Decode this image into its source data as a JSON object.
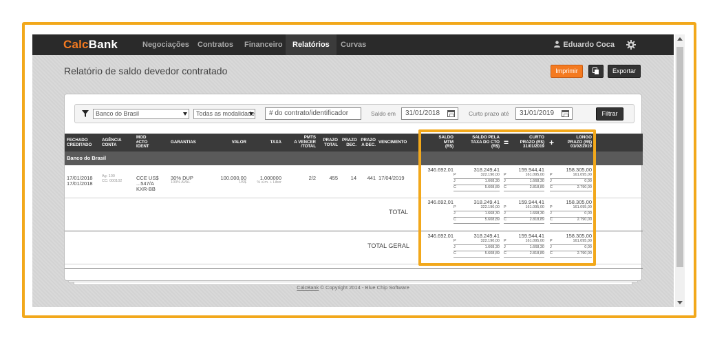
{
  "app": {
    "brand_a": "Calc",
    "brand_b": "Bank"
  },
  "nav": [
    "Negociações",
    "Contratos",
    "Financeiro",
    "Relatórios",
    "Curvas"
  ],
  "user": {
    "name": "Eduardo Coca"
  },
  "page": {
    "title": "Relatório de saldo devedor contratado",
    "print_label": "Imprimir",
    "export_label": "Exportar"
  },
  "filters": {
    "bank": "Banco do Brasil",
    "modality": "Todas as modalidades",
    "contract_placeholder": "# do contrato/identificador",
    "balance_label": "Saldo em",
    "balance_date": "31/01/2018",
    "short_term_label": "Curto prazo até",
    "short_term_date": "31/01/2019",
    "filter_button": "Filtrar"
  },
  "table": {
    "headers": {
      "fechado": [
        "FECHADO",
        "CREDITADO"
      ],
      "agencia": [
        "AGÊNCIA",
        "CONTA"
      ],
      "mod": [
        "MOD",
        "#CTO",
        "IDENT"
      ],
      "garantias": "GARANTIAS",
      "valor": "VALOR",
      "taxa": "TAXA",
      "pmts": [
        "PMTS",
        "A VENCER",
        "/TOTAL"
      ],
      "prazo_total": [
        "PRAZO",
        "TOTAL"
      ],
      "prazo_dec": [
        "PRAZO",
        "DEC."
      ],
      "prazo_adec": [
        "PRAZO",
        "A DEC."
      ],
      "vencimento": "VENCIMENTO",
      "saldo_mtm": [
        "SALDO",
        "MTM",
        "(R$)"
      ],
      "saldo_cto": [
        "SALDO PELA",
        "TAXA DO CTO",
        "(R$)"
      ],
      "curto": [
        "CURTO",
        "PRAZO (R$)",
        "31/01/2019"
      ],
      "longo": [
        "LONGO",
        "PRAZO (R$)",
        "01/02/2019"
      ]
    },
    "group": "Banco do Brasil",
    "row": {
      "fechado": "17/01/2018",
      "creditado": "17/01/2018",
      "agencia": "Ag: 100",
      "conta": "CC: 000102",
      "mod": "CCE US$",
      "cto": "...547/A",
      "ident": "KXR-BB",
      "garantias": "30% DUP",
      "garantias_sub": "100% AVAL",
      "valor": "100.000,00",
      "valor_sub": "US$",
      "taxa": "1,000000",
      "taxa_sub": "% a.m. + Libor",
      "pmts": "2/2",
      "prazo_total": "455",
      "prazo_dec": "14",
      "prazo_adec": "441",
      "vencimento": "17/04/2019"
    },
    "total_label": "TOTAL",
    "grand_total_label": "TOTAL GERAL",
    "values": {
      "mtm": "346.692,01",
      "cto": {
        "main": "318.249,41",
        "P": "322.190,00",
        "J": "1.668,30",
        "C": "5.608,89"
      },
      "curto": {
        "main": "159.944,41",
        "P": "161.095,00",
        "J": "1.668,30",
        "C": "2.818,89"
      },
      "longo": {
        "main": "158.305,00",
        "P": "161.095,00",
        "J": "0,00",
        "C": "2.790,00"
      }
    },
    "sub_keys": [
      "P",
      "J",
      "C"
    ]
  },
  "footer": {
    "link": "CalcBank",
    "text": " © Copyright 2014 - Blue Chip Software"
  },
  "colors": {
    "accent": "#f47a20",
    "highlight": "#f2a81b",
    "nav_bg": "#2a2a2a"
  }
}
